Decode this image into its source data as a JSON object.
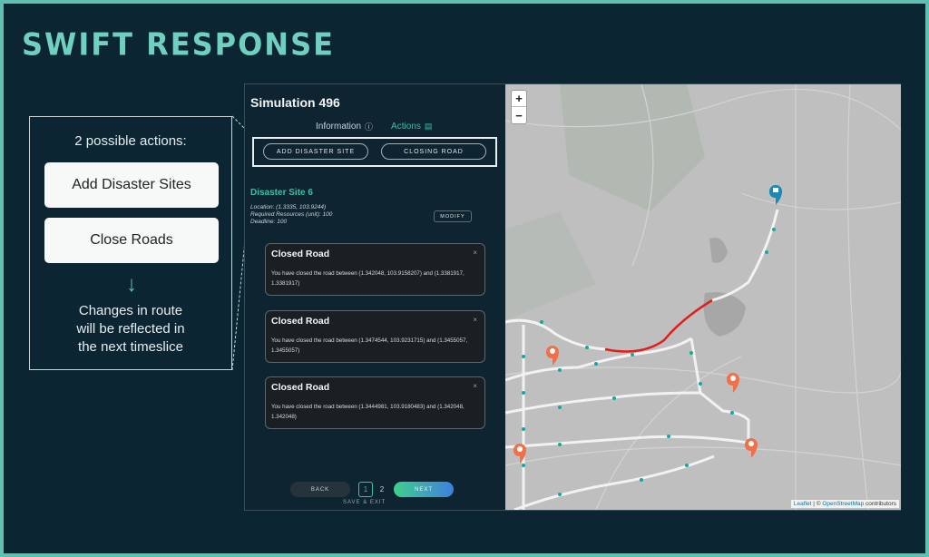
{
  "brand": {
    "title": "SWIFT RESPONSE"
  },
  "explain": {
    "title": "2 possible actions:",
    "actions": [
      "Add Disaster Sites",
      "Close Roads"
    ],
    "arrow_glyph": "↓",
    "note_lines": [
      "Changes in route",
      "will be reflected in",
      "the next timeslice"
    ]
  },
  "app": {
    "title": "Simulation 496",
    "tabs": [
      {
        "label": "Information",
        "icon": "info-icon",
        "active": false
      },
      {
        "label": "Actions",
        "icon": "clipboard-icon",
        "active": true
      }
    ],
    "buttons": {
      "add_disaster_site": "ADD DISASTER SITE",
      "closing_road": "CLOSING ROAD"
    },
    "disaster_site": {
      "title": "Disaster Site 6",
      "location": "Location: (1.3335, 103.9244)",
      "resources": "Required Resources (unit): 100",
      "deadline": "Deadline: 100",
      "modify_label": "MODIFY"
    },
    "toasts": [
      {
        "title": "Closed Road",
        "close": "×",
        "body": "You have closed the road between (1.342048, 103.9158207) and (1.3381917, 1.3381917)"
      },
      {
        "title": "Closed Road",
        "close": "×",
        "body": "You have closed the road between (1.3474544, 103.9231715) and (1.3455057, 1.3455057)"
      },
      {
        "title": "Closed Road",
        "close": "×",
        "body": "You have closed the road between (1.3444981, 103.9180483) and (1.342048, 1.342048)"
      }
    ],
    "pagination": {
      "back": "BACK",
      "pages": [
        "1",
        "2"
      ],
      "current": "1",
      "next": "NEXT",
      "save_exit": "SAVE & EXIT"
    }
  },
  "map": {
    "zoom_in": "+",
    "zoom_out": "−",
    "attribution": {
      "leaflet": "Leaflet",
      "sep": " | © ",
      "osm": "OpenStreetMap",
      "suffix": " contributors"
    },
    "colors": {
      "closed_road": "#e01e1e",
      "route": "#f2f2f2",
      "route_dots": "#17a89a",
      "disaster_pin": "#f0704a",
      "home_pin": "#1d8ab5"
    }
  }
}
